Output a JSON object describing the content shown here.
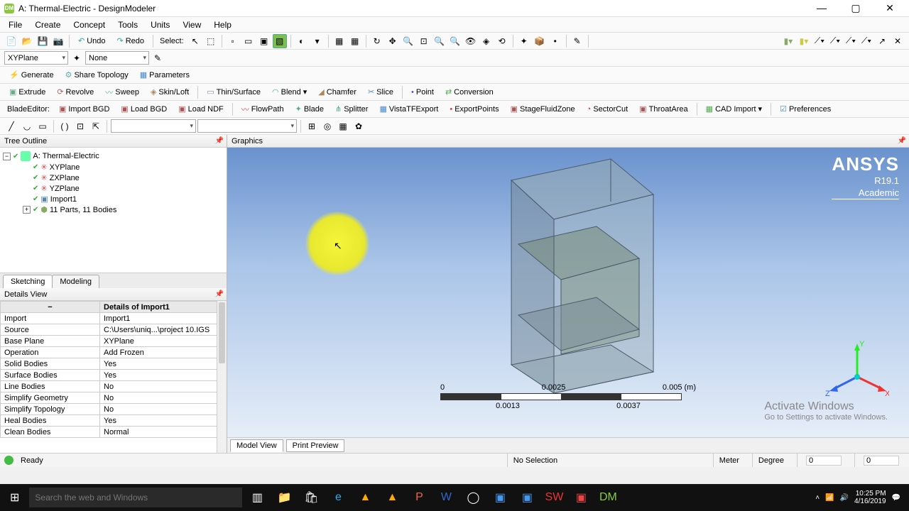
{
  "window": {
    "title": "A: Thermal-Electric - DesignModeler",
    "app_icon_text": "DM"
  },
  "menubar": [
    "File",
    "Create",
    "Concept",
    "Tools",
    "Units",
    "View",
    "Help"
  ],
  "toolbar1": {
    "undo": "Undo",
    "redo": "Redo",
    "select_label": "Select:"
  },
  "toolbar_plane": {
    "plane_value": "XYPlane",
    "sketch_value": "None"
  },
  "toolbar3": {
    "generate": "Generate",
    "share_topology": "Share Topology",
    "parameters": "Parameters"
  },
  "toolbar4": {
    "extrude": "Extrude",
    "revolve": "Revolve",
    "sweep": "Sweep",
    "skinloft": "Skin/Loft",
    "thin": "Thin/Surface",
    "blend": "Blend",
    "chamfer": "Chamfer",
    "slice": "Slice",
    "point": "Point",
    "conversion": "Conversion"
  },
  "toolbar5": {
    "blade_editor": "BladeEditor:",
    "import_bgd": "Import BGD",
    "load_bgd": "Load BGD",
    "load_ndf": "Load NDF",
    "flowpath": "FlowPath",
    "blade": "Blade",
    "splitter": "Splitter",
    "vistatf": "VistaTFExport",
    "export_points": "ExportPoints",
    "stage_fluid": "StageFluidZone",
    "sector_cut": "SectorCut",
    "throat_area": "ThroatArea",
    "cad_import": "CAD Import",
    "preferences": "Preferences"
  },
  "tree": {
    "header": "Tree Outline",
    "root": "A: Thermal-Electric",
    "nodes": [
      "XYPlane",
      "ZXPlane",
      "YZPlane",
      "Import1",
      "11 Parts, 11 Bodies"
    ],
    "tabs": [
      "Sketching",
      "Modeling"
    ]
  },
  "details": {
    "header": "Details View",
    "section": "Details of Import1",
    "rows": [
      {
        "k": "Import",
        "v": "Import1"
      },
      {
        "k": "Source",
        "v": "C:\\Users\\uniq...\\project 10.IGS"
      },
      {
        "k": "Base Plane",
        "v": "XYPlane"
      },
      {
        "k": "Operation",
        "v": "Add Frozen"
      },
      {
        "k": "Solid Bodies",
        "v": "Yes"
      },
      {
        "k": "Surface Bodies",
        "v": "Yes"
      },
      {
        "k": "Line Bodies",
        "v": "No"
      },
      {
        "k": "Simplify Geometry",
        "v": "No"
      },
      {
        "k": "Simplify Topology",
        "v": "No"
      },
      {
        "k": "Heal Bodies",
        "v": "Yes"
      },
      {
        "k": "Clean Bodies",
        "v": "Normal"
      }
    ]
  },
  "graphics": {
    "header": "Graphics",
    "brand": "ANSYS",
    "version": "R19.1",
    "academic": "Academic",
    "scale_top": [
      "0",
      "0.0025",
      "0.005 (m)"
    ],
    "scale_bot": [
      "0.0013",
      "0.0037"
    ],
    "axes": {
      "x": "X",
      "y": "Y",
      "z": "Z"
    },
    "watermark1": "Activate Windows",
    "watermark2": "Go to Settings to activate Windows.",
    "tabs": [
      "Model View",
      "Print Preview"
    ]
  },
  "status": {
    "ready": "Ready",
    "selection": "No Selection",
    "units1": "Meter",
    "units2": "Degree",
    "val1": "0",
    "val2": "0"
  },
  "taskbar": {
    "search_placeholder": "Search the web and Windows",
    "time": "10:25 PM",
    "date": "4/16/2019"
  }
}
